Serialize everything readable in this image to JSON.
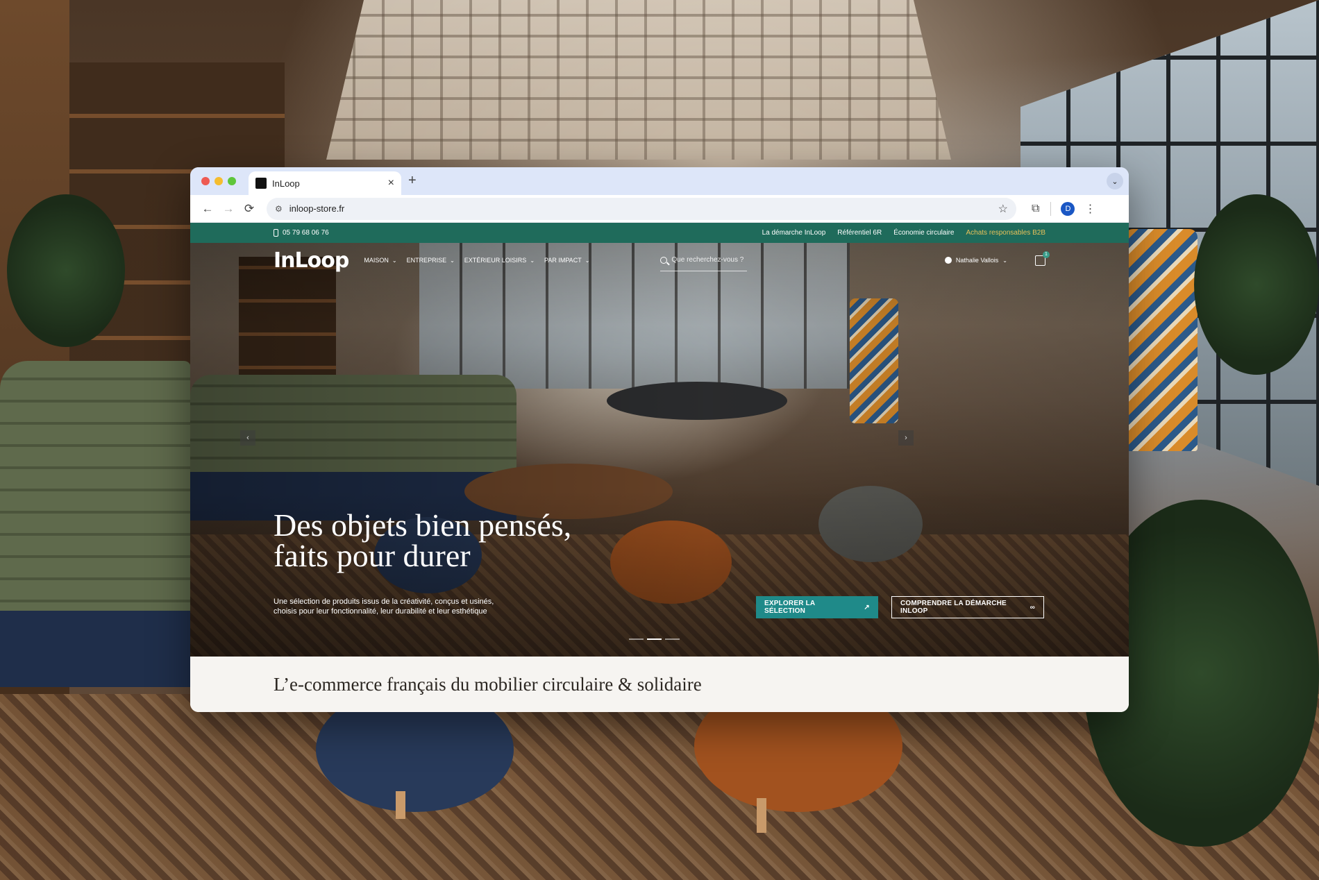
{
  "browser": {
    "tab_title": "InLoop",
    "new_tab": "+",
    "close": "×",
    "tab_menu": "⌄",
    "back": "←",
    "forward": "→",
    "reload": "⟳",
    "url": "inloop-store.fr",
    "profile_initial": "D",
    "star": "☆",
    "extensions": "⧉",
    "menu": "⋮",
    "site_settings": "⚙"
  },
  "topbar": {
    "phone": "05 79 68 06 76",
    "links": [
      "La démarche InLoop",
      "Référentiel 6R",
      "Économie circulaire",
      "Achats responsables B2B"
    ]
  },
  "nav": {
    "logo": "InLoop",
    "items": [
      "MAISON",
      "ENTREPRISE",
      "EXTÉRIEUR LOISIRS",
      "PAR IMPACT"
    ],
    "search_placeholder": "Que recherchez-vous ?",
    "user_name": "Nathalie Vallois",
    "cart_count": "1"
  },
  "hero": {
    "title_line1": "Des objets bien pensés,",
    "title_line2": "faits pour durer",
    "subtitle": "Une sélection de produits issus de la créativité, conçus et usinés, choisis pour leur fonctionnalité, leur durabilité et leur esthétique",
    "primary_cta": "EXPLORER LA SÉLECTION",
    "secondary_cta": "COMPRENDRE LA DÉMARCHE INLOOP",
    "prev": "‹",
    "next": "›",
    "slide_count": 3,
    "active_slide": 2
  },
  "tagline": "L’e-commerce français du mobilier circulaire & solidaire",
  "colors": {
    "topbar": "#1f6b5b",
    "primary_button": "#1f8a89",
    "tabbar": "#dde6f9"
  }
}
